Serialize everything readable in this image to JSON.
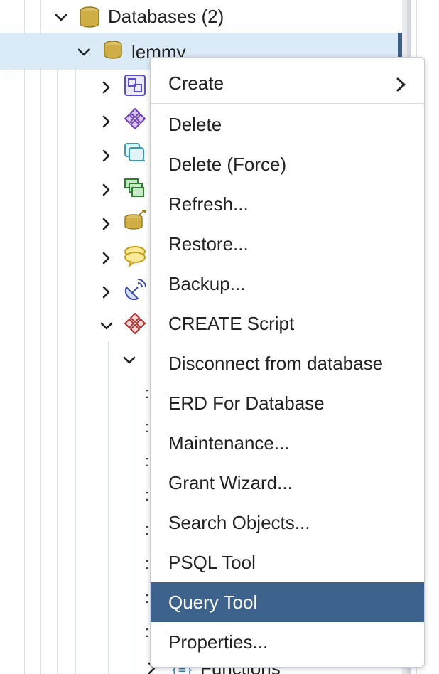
{
  "tree": {
    "databases_label": "Databases (2)",
    "selected_db_label": "lemmy",
    "bottom_label": "Functions"
  },
  "context_menu": {
    "items": [
      {
        "label": "Create",
        "submenu": true
      },
      {
        "label": "Delete"
      },
      {
        "label": "Delete (Force)"
      },
      {
        "label": "Refresh..."
      },
      {
        "label": "Restore..."
      },
      {
        "label": "Backup..."
      },
      {
        "label": "CREATE Script"
      },
      {
        "label": "Disconnect from database"
      },
      {
        "label": "ERD For Database"
      },
      {
        "label": "Maintenance..."
      },
      {
        "label": "Grant Wizard..."
      },
      {
        "label": "Search Objects..."
      },
      {
        "label": "PSQL Tool"
      },
      {
        "label": "Query Tool",
        "active": true
      },
      {
        "label": "Properties..."
      }
    ],
    "active_color": "#3d628c"
  },
  "colors": {
    "selection_bg": "#dbeaf7",
    "db_icon": "#c8a848",
    "accent": "#3d5f86"
  }
}
